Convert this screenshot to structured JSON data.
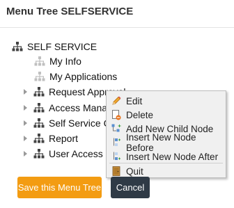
{
  "dialog": {
    "title": "Menu Tree SELFSERVICE"
  },
  "tree": {
    "root": "SELF SERVICE",
    "children": [
      {
        "label": "My Info",
        "expandable": false
      },
      {
        "label": "My Applications",
        "expandable": false
      },
      {
        "label": "Request Approval",
        "expandable": true
      },
      {
        "label": "Access Manag",
        "expandable": true
      },
      {
        "label": "Self Service C",
        "expandable": true
      },
      {
        "label": "Report",
        "expandable": true
      },
      {
        "label": "User Access",
        "expandable": true
      }
    ]
  },
  "context_menu": {
    "items": [
      {
        "label": "Edit",
        "icon": "pencil-icon"
      },
      {
        "label": "Delete",
        "icon": "delete-page-icon"
      },
      {
        "label": "Add New Child Node",
        "icon": "add-child-node-icon"
      },
      {
        "label": "Insert New Node Before",
        "icon": "insert-before-icon"
      },
      {
        "label": "Insert New Node After",
        "icon": "insert-after-icon"
      },
      {
        "label": "Quit",
        "icon": "quit-door-icon"
      }
    ]
  },
  "buttons": {
    "save": "Save this Menu Tree",
    "cancel": "Cancel"
  },
  "colors": {
    "save": "#f39c12",
    "cancel": "#2f3a46",
    "org_icon_active": "#444444",
    "org_icon_leaf": "#c0c0c0"
  }
}
